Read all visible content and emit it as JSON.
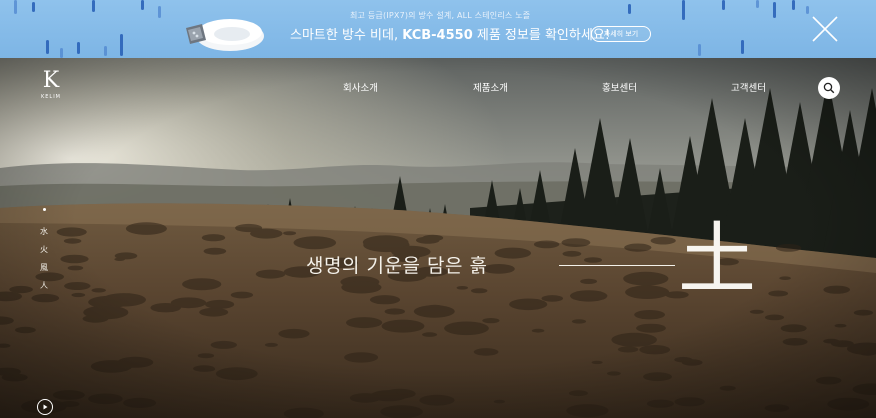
{
  "banner": {
    "small_text": "최고 등급(IPX7)의 방수 설계, ALL 스테인리스 노즐",
    "main_prefix": "스마트한 방수 비데, ",
    "main_model": "KCB-4550",
    "main_suffix": " 제품 정보를 확인하세요!",
    "detail_button": "자세히 보기",
    "close_icon": "close-icon",
    "background_color": "#85bbe8",
    "drop_color": "#2a63b8"
  },
  "header": {
    "logo_letter": "K",
    "logo_text": "KELIM",
    "nav": [
      "회사소개",
      "제품소개",
      "홍보센터",
      "고객센터"
    ],
    "search_icon": "search-icon"
  },
  "side_nav": {
    "items": [
      "水",
      "火",
      "風",
      "人"
    ]
  },
  "hero": {
    "headline": "생명의 기운을 담은 흙",
    "symbol": "土",
    "play_icon": "play-icon"
  }
}
